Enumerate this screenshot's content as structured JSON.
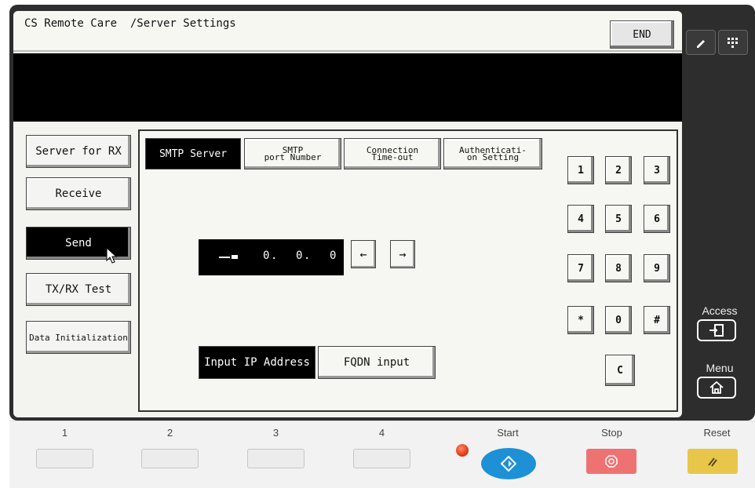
{
  "header": {
    "title": "CS Remote Care  /Server Settings",
    "end_label": "END"
  },
  "left_menu": [
    {
      "label": "Server for RX"
    },
    {
      "label": "Receive"
    },
    {
      "label": "Send",
      "selected": true
    },
    {
      "label": "TX/RX Test"
    },
    {
      "label": "Data Initialization"
    }
  ],
  "tabs": {
    "smtp_server": "SMTP Server",
    "smtp_port_line1": "SMTP",
    "smtp_port_line2": "port Number",
    "conn_line1": "Connection",
    "conn_line2": "Time-out",
    "auth_line1": "Authenticati-",
    "auth_line2": "on Setting"
  },
  "ip": {
    "oct1": "0",
    "oct2": "0",
    "oct3": "0",
    "left": "←",
    "right": "→"
  },
  "mode": {
    "ip": "Input IP Address",
    "fqdn": "FQDN input"
  },
  "keypad": [
    "1",
    "2",
    "3",
    "4",
    "5",
    "6",
    "7",
    "8",
    "9",
    "*",
    "0",
    "#",
    "C"
  ],
  "side": {
    "access": "Access",
    "menu": "Menu"
  },
  "hardware": {
    "b1": "1",
    "b2": "2",
    "b3": "3",
    "b4": "4",
    "start": "Start",
    "stop": "Stop",
    "reset": "Reset"
  },
  "colors": {
    "start": "#1e90d6",
    "stop": "#ef7272",
    "reset": "#e7c64a",
    "led": "#e63a16"
  }
}
